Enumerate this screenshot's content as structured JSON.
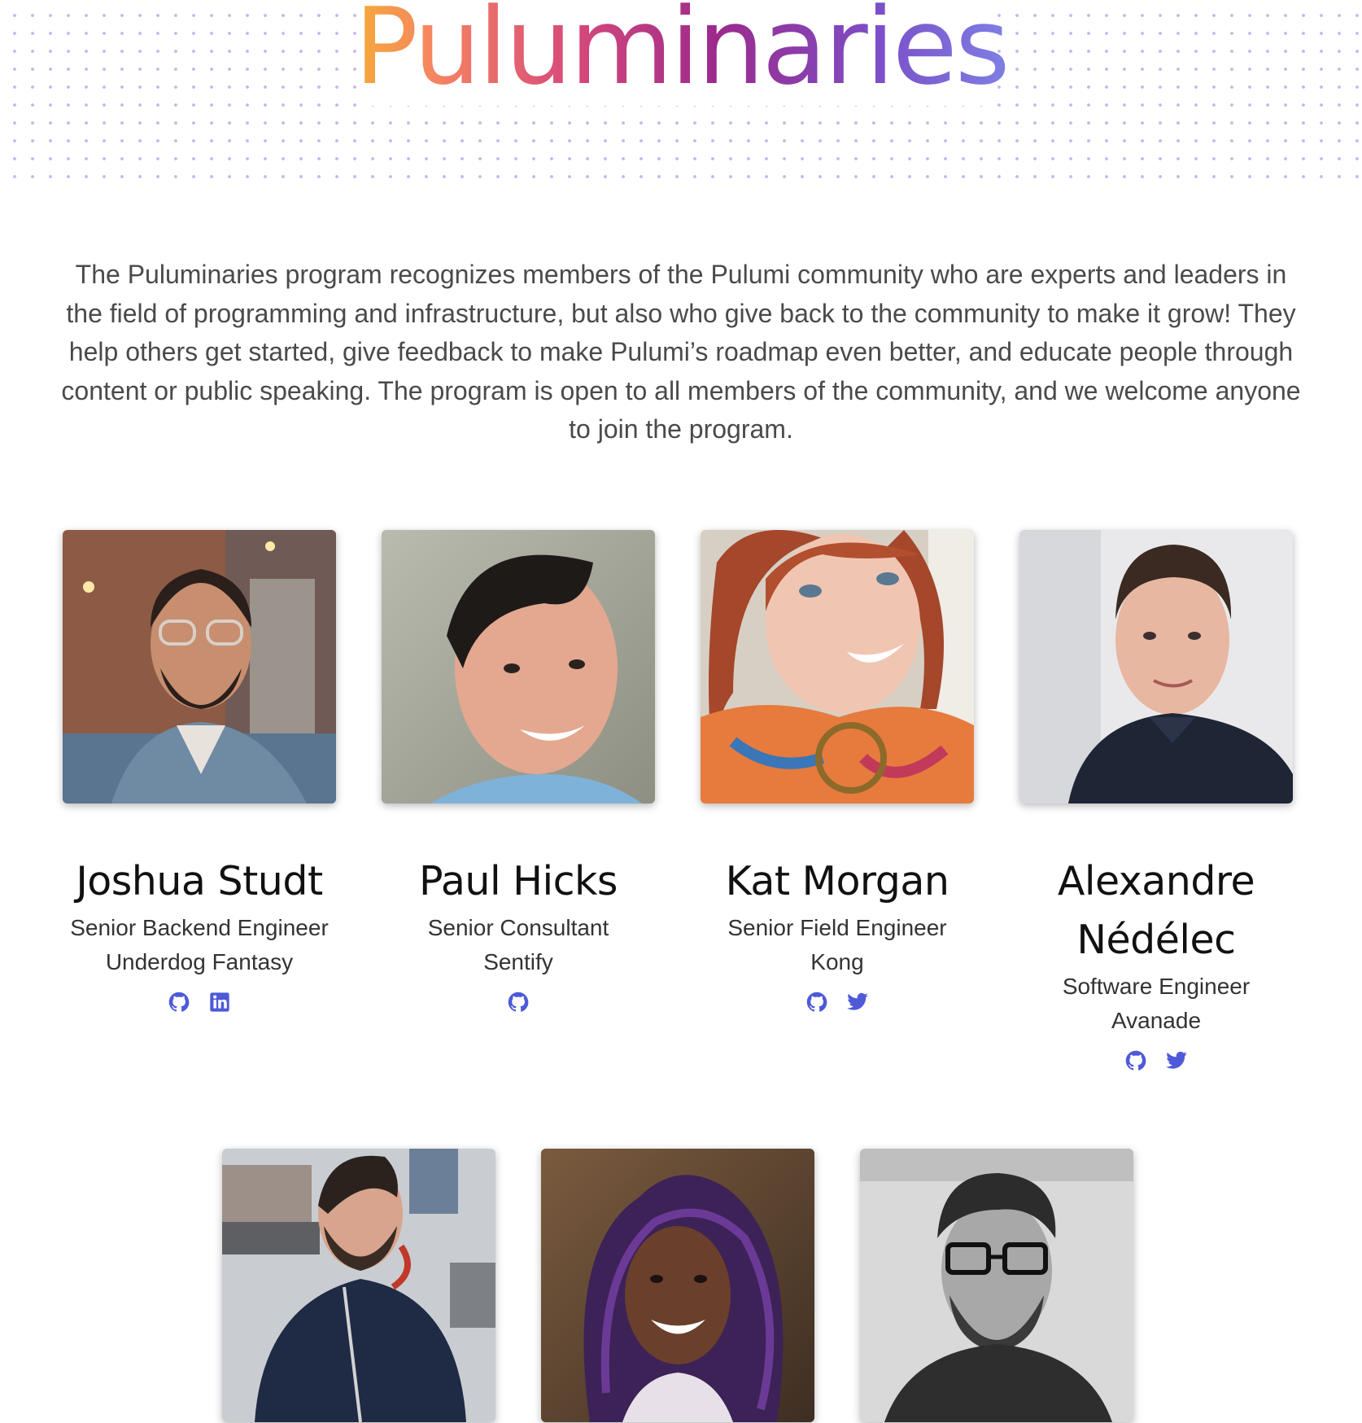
{
  "page": {
    "title": "Puluminaries",
    "intro": "The Puluminaries program recognizes members of the Pulumi community who are experts and leaders in the field of programming and infrastructure, but also who give back to the community to make it grow! They help others get started, give feedback to make Pulumi’s roadmap even better, and educate people through content or public speaking. The program is open to all members of the community, and we welcome anyone to join the program."
  },
  "colors": {
    "accent_icon": "#4e5ad8",
    "title_gradient": [
      "#f5b52f",
      "#f58363",
      "#d5487a",
      "#9c2a8c",
      "#7c4ec7",
      "#7e87ea"
    ],
    "dots": "#c8b6ec"
  },
  "members": [
    {
      "name": "Joshua Studt",
      "role": "Senior Backend Engineer",
      "company": "Underdog Fantasy",
      "links": [
        "github-icon",
        "linkedin-icon"
      ]
    },
    {
      "name": "Paul Hicks",
      "role": "Senior Consultant",
      "company": "Sentify",
      "links": [
        "github-icon"
      ]
    },
    {
      "name": "Kat Morgan",
      "role": "Senior Field Engineer",
      "company": "Kong",
      "links": [
        "github-icon",
        "twitter-icon"
      ]
    },
    {
      "name": "Alexandre Nédélec",
      "role": "Software Engineer",
      "company": "Avanade",
      "links": [
        "github-icon",
        "twitter-icon"
      ]
    },
    {
      "name": "",
      "role": "",
      "company": "",
      "links": []
    },
    {
      "name": "",
      "role": "",
      "company": "",
      "links": []
    },
    {
      "name": "",
      "role": "",
      "company": "",
      "links": []
    }
  ]
}
